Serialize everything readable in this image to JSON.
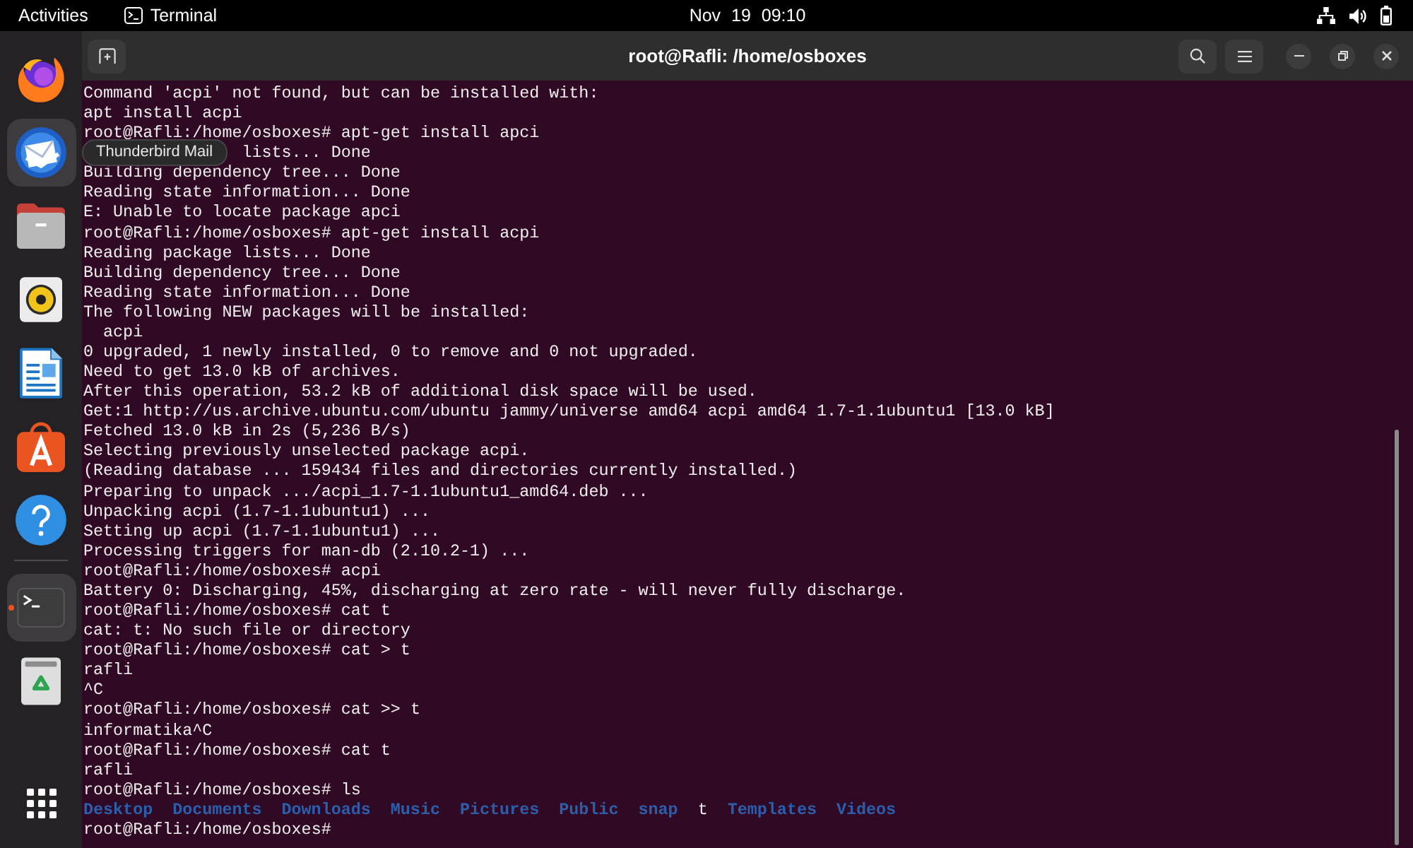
{
  "top_bar": {
    "activities": "Activities",
    "app_name": "Terminal",
    "clock": "Nov 19 09:10"
  },
  "dock": {
    "items": [
      {
        "kind": "browser",
        "highlighted": false,
        "running": false
      },
      {
        "kind": "mail",
        "highlighted": true,
        "running": false,
        "tooltip": "Thunderbird Mail"
      },
      {
        "kind": "files",
        "highlighted": false,
        "running": false
      },
      {
        "kind": "music",
        "highlighted": false,
        "running": false
      },
      {
        "kind": "document",
        "highlighted": false,
        "running": false
      },
      {
        "kind": "store",
        "highlighted": false,
        "running": false
      },
      {
        "kind": "help",
        "highlighted": false,
        "running": false
      },
      {
        "kind": "separator"
      },
      {
        "kind": "terminal",
        "highlighted": true,
        "running": true
      },
      {
        "kind": "trash",
        "highlighted": false,
        "running": false
      },
      {
        "kind": "app_grid",
        "highlighted": false,
        "running": false
      }
    ]
  },
  "window": {
    "title": "root@Rafli: /home/osboxes"
  },
  "terminal": {
    "lines": [
      {
        "kind": "output",
        "text": "Command 'acpi' not found, but can be installed with:"
      },
      {
        "kind": "output",
        "text": "apt install acpi"
      },
      {
        "kind": "prompt",
        "text": "root@Rafli:/home/osboxes# apt-get install apci"
      },
      {
        "kind": "partly_covered",
        "text": "lists... Done"
      },
      {
        "kind": "output",
        "text": "Building dependency tree... Done"
      },
      {
        "kind": "output",
        "text": "Reading state information... Done"
      },
      {
        "kind": "output",
        "text": "E: Unable to locate package apci"
      },
      {
        "kind": "prompt",
        "text": "root@Rafli:/home/osboxes# apt-get install acpi"
      },
      {
        "kind": "output",
        "text": "Reading package lists... Done"
      },
      {
        "kind": "output",
        "text": "Building dependency tree... Done"
      },
      {
        "kind": "output",
        "text": "Reading state information... Done"
      },
      {
        "kind": "output",
        "text": "The following NEW packages will be installed:"
      },
      {
        "kind": "output",
        "text": "  acpi"
      },
      {
        "kind": "output",
        "text": "0 upgraded, 1 newly installed, 0 to remove and 0 not upgraded."
      },
      {
        "kind": "output",
        "text": "Need to get 13.0 kB of archives."
      },
      {
        "kind": "output",
        "text": "After this operation, 53.2 kB of additional disk space will be used."
      },
      {
        "kind": "output",
        "text": "Get:1 http://us.archive.ubuntu.com/ubuntu jammy/universe amd64 acpi amd64 1.7-1.1ubuntu1 [13.0 kB]"
      },
      {
        "kind": "output",
        "text": "Fetched 13.0 kB in 2s (5,236 B/s)"
      },
      {
        "kind": "output",
        "text": "Selecting previously unselected package acpi."
      },
      {
        "kind": "output",
        "text": "(Reading database ... 159434 files and directories currently installed.)"
      },
      {
        "kind": "output",
        "text": "Preparing to unpack .../acpi_1.7-1.1ubuntu1_amd64.deb ..."
      },
      {
        "kind": "output",
        "text": "Unpacking acpi (1.7-1.1ubuntu1) ..."
      },
      {
        "kind": "output",
        "text": "Setting up acpi (1.7-1.1ubuntu1) ..."
      },
      {
        "kind": "output",
        "text": "Processing triggers for man-db (2.10.2-1) ..."
      },
      {
        "kind": "prompt",
        "text": "root@Rafli:/home/osboxes# acpi"
      },
      {
        "kind": "output",
        "text": "Battery 0: Discharging, 45%, discharging at zero rate - will never fully discharge."
      },
      {
        "kind": "prompt",
        "text": "root@Rafli:/home/osboxes# cat t"
      },
      {
        "kind": "output",
        "text": "cat: t: No such file or directory"
      },
      {
        "kind": "prompt",
        "text": "root@Rafli:/home/osboxes# cat > t"
      },
      {
        "kind": "output",
        "text": "rafli"
      },
      {
        "kind": "output",
        "text": "^C"
      },
      {
        "kind": "prompt",
        "text": "root@Rafli:/home/osboxes# cat >> t"
      },
      {
        "kind": "output",
        "text": "informatika^C"
      },
      {
        "kind": "prompt",
        "text": "root@Rafli:/home/osboxes# cat t"
      },
      {
        "kind": "output",
        "text": "rafli"
      },
      {
        "kind": "prompt",
        "text": "root@Rafli:/home/osboxes# ls"
      },
      {
        "kind": "listing",
        "entries": [
          {
            "kind": "directory",
            "name": "Desktop"
          },
          {
            "kind": "directory",
            "name": "Documents"
          },
          {
            "kind": "directory",
            "name": "Downloads"
          },
          {
            "kind": "directory",
            "name": "Music"
          },
          {
            "kind": "directory",
            "name": "Pictures"
          },
          {
            "kind": "directory",
            "name": "Public"
          },
          {
            "kind": "directory",
            "name": "snap"
          },
          {
            "kind": "file",
            "name": "t"
          },
          {
            "kind": "directory",
            "name": "Templates"
          },
          {
            "kind": "directory",
            "name": "Videos"
          }
        ]
      },
      {
        "kind": "prompt",
        "text": "root@Rafli:/home/osboxes#"
      }
    ]
  }
}
